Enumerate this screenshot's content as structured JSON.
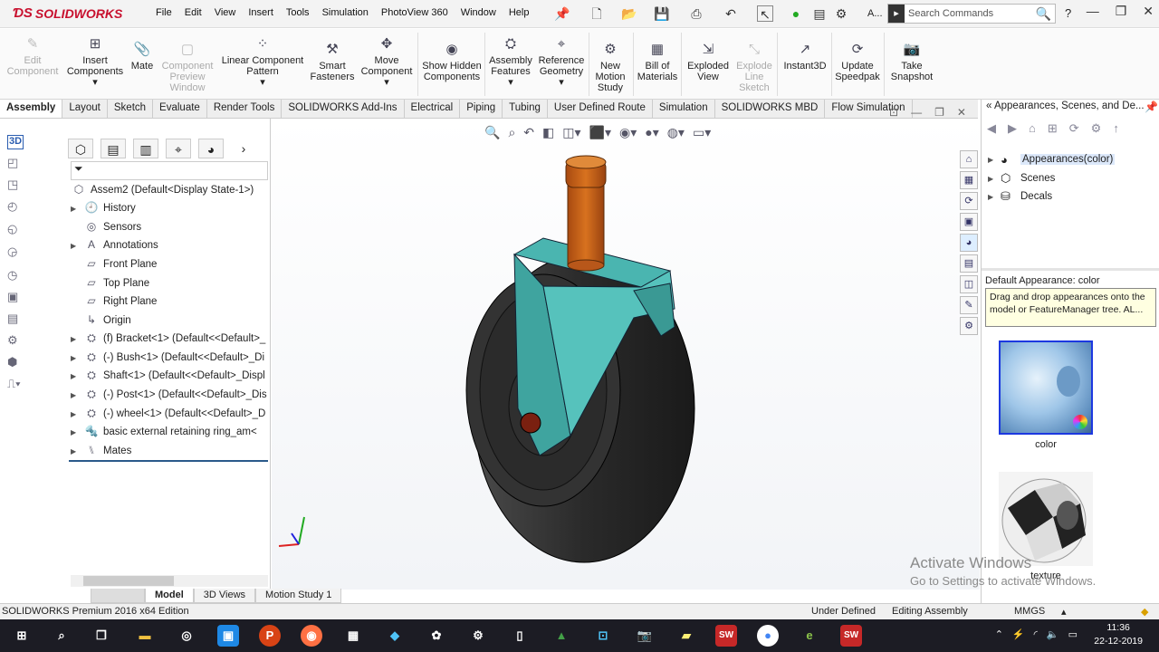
{
  "app": {
    "brand": "SOLIDWORKS",
    "brand_color": "#c8102e"
  },
  "menus": [
    "File",
    "Edit",
    "View",
    "Insert",
    "Tools",
    "Simulation",
    "PhotoView 360",
    "Window",
    "Help"
  ],
  "search": {
    "placeholder": "Search Commands"
  },
  "commands": [
    {
      "label": "Edit Component",
      "icon": "edit-component-icon",
      "enabled": false
    },
    {
      "label": "Insert Components",
      "icon": "insert-components-icon",
      "enabled": true
    },
    {
      "label": "Mate",
      "icon": "mate-icon",
      "enabled": true
    },
    {
      "label": "Component Preview Window",
      "icon": "component-preview-icon",
      "enabled": false
    },
    {
      "label": "Linear Component Pattern",
      "icon": "linear-pattern-icon",
      "enabled": true
    },
    {
      "label": "Smart Fasteners",
      "icon": "smart-fasteners-icon",
      "enabled": true
    },
    {
      "label": "Move Component",
      "icon": "move-component-icon",
      "enabled": true
    },
    {
      "label": "Show Hidden Components",
      "icon": "show-hidden-icon",
      "enabled": true
    },
    {
      "label": "Assembly Features",
      "icon": "assembly-features-icon",
      "enabled": true
    },
    {
      "label": "Reference Geometry",
      "icon": "reference-geometry-icon",
      "enabled": true
    },
    {
      "label": "New Motion Study",
      "icon": "motion-study-icon",
      "enabled": true
    },
    {
      "label": "Bill of Materials",
      "icon": "bom-icon",
      "enabled": true
    },
    {
      "label": "Exploded View",
      "icon": "exploded-view-icon",
      "enabled": true
    },
    {
      "label": "Explode Line Sketch",
      "icon": "explode-line-icon",
      "enabled": false
    },
    {
      "label": "Instant3D",
      "icon": "instant3d-icon",
      "enabled": true
    },
    {
      "label": "Update Speedpak",
      "icon": "speedpak-icon",
      "enabled": true
    },
    {
      "label": "Take Snapshot",
      "icon": "camera-icon",
      "enabled": true
    }
  ],
  "tabs": [
    "Assembly",
    "Layout",
    "Sketch",
    "Evaluate",
    "Render Tools",
    "SOLIDWORKS Add-Ins",
    "Electrical",
    "Piping",
    "Tubing",
    "User Defined Route",
    "Simulation",
    "SOLIDWORKS MBD",
    "Flow Simulation"
  ],
  "active_tab": "Assembly",
  "tree": {
    "root": "Assem2  (Default<Display State-1>)",
    "items": [
      {
        "label": "History",
        "icon": "history-icon",
        "expandable": true
      },
      {
        "label": "Sensors",
        "icon": "sensor-icon",
        "expandable": false
      },
      {
        "label": "Annotations",
        "icon": "annotation-icon",
        "expandable": true
      },
      {
        "label": "Front Plane",
        "icon": "plane-icon",
        "expandable": false
      },
      {
        "label": "Top Plane",
        "icon": "plane-icon",
        "expandable": false
      },
      {
        "label": "Right Plane",
        "icon": "plane-icon",
        "expandable": false
      },
      {
        "label": "Origin",
        "icon": "origin-icon",
        "expandable": false
      },
      {
        "label": "(f) Bracket<1> (Default<<Default>_",
        "icon": "part-icon",
        "expandable": true
      },
      {
        "label": "(-) Bush<1> (Default<<Default>_Di",
        "icon": "part-icon",
        "expandable": true
      },
      {
        "label": "Shaft<1> (Default<<Default>_Displ",
        "icon": "part-icon",
        "expandable": true
      },
      {
        "label": "(-) Post<1> (Default<<Default>_Dis",
        "icon": "part-icon",
        "expandable": true
      },
      {
        "label": "(-) wheel<1> (Default<<Default>_D",
        "icon": "part-icon",
        "expandable": true
      },
      {
        "label": "basic external retaining ring_am<",
        "icon": "toolbox-part-icon",
        "expandable": true
      },
      {
        "label": "Mates",
        "icon": "mates-icon",
        "expandable": true
      }
    ]
  },
  "bottom_tabs": [
    "Model",
    "3D Views",
    "Motion Study 1"
  ],
  "status": {
    "edition": "SOLIDWORKS Premium 2016 x64 Edition",
    "definition": "Under Defined",
    "mode": "Editing Assembly",
    "units": "MMGS"
  },
  "task_pane": {
    "title": "Appearances, Scenes, and De...",
    "items": [
      {
        "label": "Appearances(color)",
        "icon": "appearance-icon",
        "selected": true
      },
      {
        "label": "Scenes",
        "icon": "scene-icon",
        "selected": false
      },
      {
        "label": "Decals",
        "icon": "decal-icon",
        "selected": false
      }
    ],
    "default_label": "Default Appearance: color",
    "tooltip": "Drag and drop appearances onto the model or FeatureManager tree.  AL...",
    "thumbs": [
      {
        "label": "color"
      },
      {
        "label": "texture"
      }
    ]
  },
  "activation": {
    "title": "Activate Windows",
    "subtitle": "Go to Settings to activate Windows."
  },
  "clock": {
    "time": "11:36",
    "date": "22-12-2019"
  },
  "model_colors": {
    "bracket": "#4ab5b0",
    "post": "#c75e1a",
    "wheel": "#2a2a2a"
  }
}
